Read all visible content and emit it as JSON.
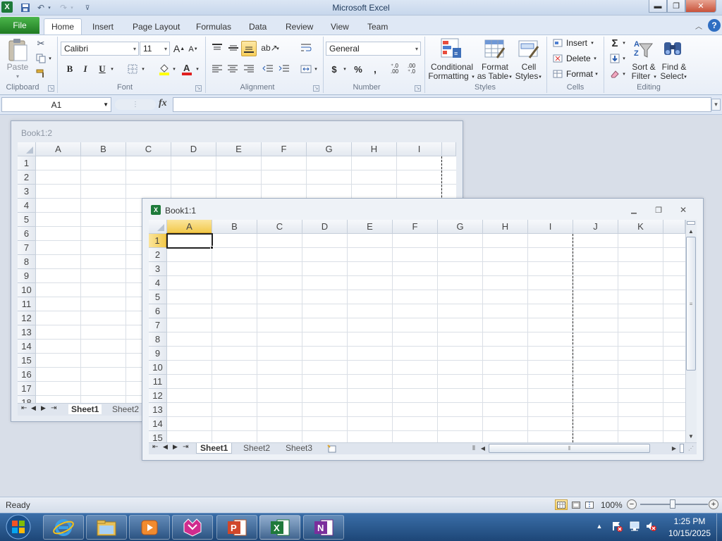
{
  "app": {
    "title": "Microsoft Excel"
  },
  "tabs": [
    {
      "label": "File"
    },
    {
      "label": "Home"
    },
    {
      "label": "Insert"
    },
    {
      "label": "Page Layout"
    },
    {
      "label": "Formulas"
    },
    {
      "label": "Data"
    },
    {
      "label": "Review"
    },
    {
      "label": "View"
    },
    {
      "label": "Team"
    }
  ],
  "ribbon": {
    "clipboard": {
      "paste": "Paste",
      "group": "Clipboard"
    },
    "font": {
      "name": "Calibri",
      "size": "11",
      "bold": "B",
      "italic": "I",
      "underline": "U",
      "group": "Font"
    },
    "alignment": {
      "group": "Alignment"
    },
    "number": {
      "format": "General",
      "currency": "$",
      "percent": "%",
      "comma": ",",
      "inc_decimal": "⁺.0 .00",
      "dec_decimal": ".00 ⁺.0",
      "group": "Number"
    },
    "styles": {
      "cond1": "Conditional",
      "cond2": "Formatting",
      "fmt1": "Format",
      "fmt2": "as Table",
      "cell1": "Cell",
      "cell2": "Styles",
      "group": "Styles"
    },
    "cells": {
      "insert": "Insert",
      "delete": "Delete",
      "format": "Format",
      "group": "Cells"
    },
    "editing": {
      "sort1": "Sort &",
      "sort2": "Filter",
      "find1": "Find &",
      "find2": "Select",
      "group": "Editing"
    }
  },
  "formula_bar": {
    "name_box": "A1",
    "fx": "fx",
    "value": ""
  },
  "windows": {
    "back": {
      "title": "Book1:2",
      "columns": [
        "A",
        "B",
        "C",
        "D",
        "E",
        "F",
        "G",
        "H",
        "I"
      ],
      "rows": [
        "1",
        "2",
        "3",
        "4",
        "5",
        "6",
        "7",
        "8",
        "9",
        "10",
        "11",
        "12",
        "13",
        "14",
        "15",
        "16",
        "17",
        "18"
      ],
      "sheet_tabs": [
        "Sheet1",
        "Sheet2"
      ]
    },
    "front": {
      "title": "Book1:1",
      "columns": [
        "A",
        "B",
        "C",
        "D",
        "E",
        "F",
        "G",
        "H",
        "I",
        "J",
        "K"
      ],
      "rows": [
        "1",
        "2",
        "3",
        "4",
        "5",
        "6",
        "7",
        "8",
        "9",
        "10",
        "11",
        "12",
        "13",
        "14",
        "15"
      ],
      "sheet_tabs": [
        "Sheet1",
        "Sheet2",
        "Sheet3"
      ],
      "active_cell": "A1"
    }
  },
  "status": {
    "ready": "Ready",
    "zoom": "100%"
  },
  "taskbar": {
    "time": "1:25 PM",
    "date": "10/15/2025"
  },
  "colors": {
    "file_tab": "#2b8a2e",
    "active_cell_header": "#f5d46e",
    "taskbar": "#245b96"
  }
}
